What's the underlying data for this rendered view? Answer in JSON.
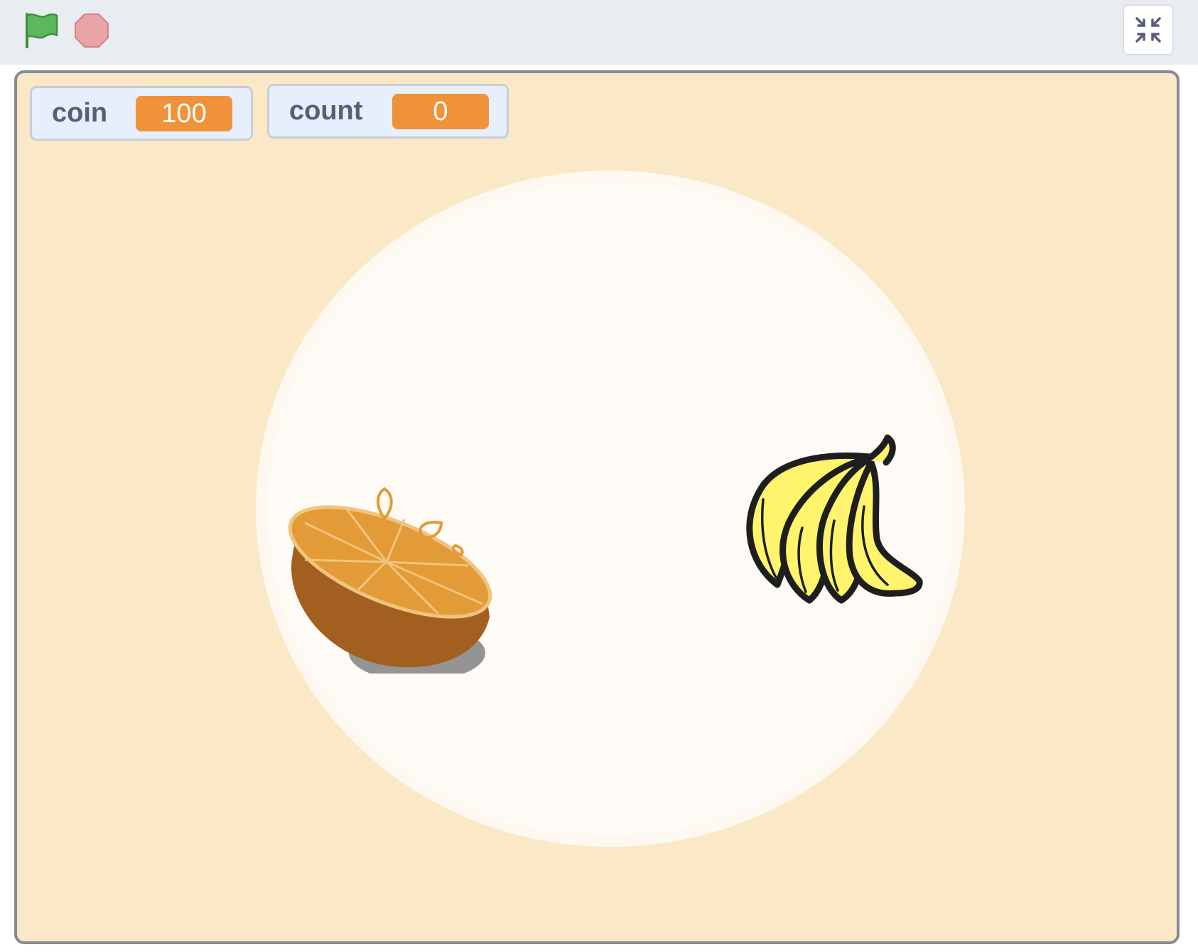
{
  "toolbar": {
    "green_flag_icon": "green-flag-icon",
    "stop_icon": "stop-sign-icon",
    "fullscreen_icon": "exit-fullscreen-icon"
  },
  "monitors": [
    {
      "label": "coin",
      "value": "100"
    },
    {
      "label": "count",
      "value": "0"
    }
  ],
  "stage": {
    "background_color": "#fae8c6",
    "plate_color": "#fefbf6",
    "sprites": [
      "orange-half",
      "banana-bunch"
    ]
  },
  "colors": {
    "toolbar_bg": "#e9edf2",
    "monitor_value_bg": "#ef923a",
    "monitor_label": "#575e75",
    "stage_border": "#858a96",
    "flag_green": "#4caf50",
    "stop_red": "#e8a4a6"
  }
}
